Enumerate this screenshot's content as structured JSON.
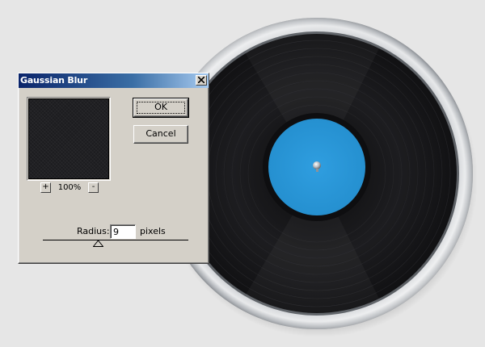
{
  "dialog": {
    "title": "Gaussian Blur",
    "close_icon": "close-icon",
    "ok_label": "OK",
    "cancel_label": "Cancel",
    "zoom_in_label": "+",
    "zoom_out_label": "-",
    "zoom_level": "100%",
    "radius_label": "Radius:",
    "radius_value": "9",
    "radius_unit": "pixels"
  },
  "colors": {
    "dialog_face": "#d4d0c8",
    "title_gradient_start": "#0a246a",
    "title_gradient_end": "#a6caf0",
    "record_label": "#2b98d8",
    "vinyl": "#1a1a1d",
    "canvas_background": "#e6e6e6"
  }
}
